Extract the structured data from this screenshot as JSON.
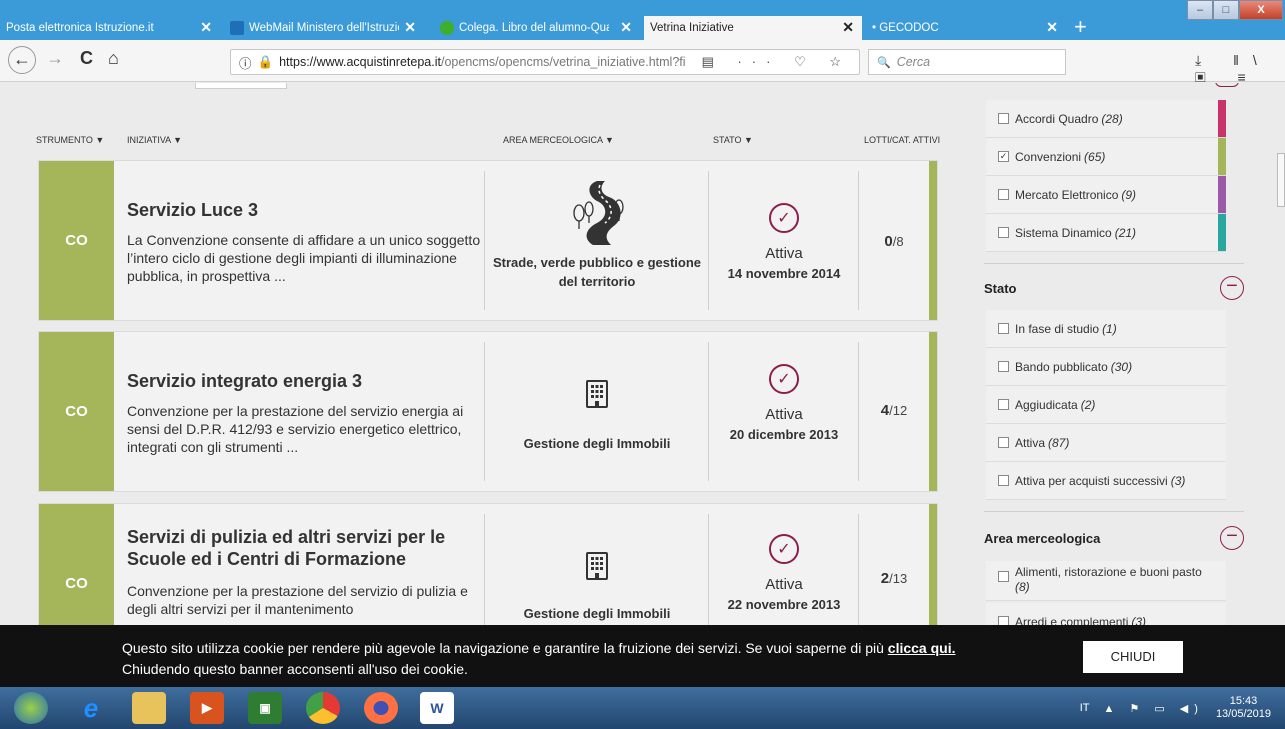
{
  "browser": {
    "tabs": [
      {
        "label": "Posta elettronica Istruzione.it",
        "icon": "none"
      },
      {
        "label": "WebMail Ministero dell'Istruzio",
        "icon": "blue"
      },
      {
        "label": "Colega. Libro del alumno-Qua",
        "icon": "green"
      },
      {
        "label": "Vetrina Iniziative",
        "icon": "none",
        "active": true
      },
      {
        "label": "• GECODOC",
        "icon": "none"
      }
    ],
    "url_host": "https://www.acquistinretepa.it",
    "url_path": "/opencms/opencms/vetrina_iniziative.html?fi",
    "search_placeholder": "Cerca",
    "close_glyph": "✕",
    "new_tab_glyph": "+",
    "min_glyph": "–",
    "max_glyph": "□",
    "win_close_glyph": "X",
    "back_glyph": "←",
    "forward_glyph": "→",
    "reload_glyph": "C",
    "home_glyph": "⌂",
    "info_glyph": "ⓘ",
    "lock_glyph": "🔒",
    "url_icons": "▤ ··· ♡ ☆",
    "search_glyph": "🔍",
    "right_icons": "⤓ ‖\\ ▣ ≡"
  },
  "columns": {
    "strumento": "STRUMENTO ▼",
    "iniziativa": "INIZIATIVA ▼",
    "area": "AREA MERCEOLOGICA ▼",
    "stato": "STATO ▼",
    "lotti": "LOTTI/CAT. ATTIVI"
  },
  "cards": [
    {
      "strumento": "CO",
      "title": "Servizio Luce 3",
      "desc": "La Convenzione consente di affidare a un unico soggetto l’intero ciclo di gestione degli impianti di illuminazione pubblica, in prospettiva ...",
      "area": "Strade, verde pubblico e gestione del territorio",
      "area_icon": "road-trees-icon",
      "stato": "Attiva",
      "date": "14 novembre 2014",
      "lotti_active": "0",
      "lotti_total": "/8"
    },
    {
      "strumento": "CO",
      "title": "Servizio integrato energia 3",
      "desc": "Convenzione per la prestazione del servizio energia ai sensi del D.P.R. 412/93 e servizio energetico elettrico, integrati con gli strumenti ...",
      "area": "Gestione degli Immobili",
      "area_icon": "building-icon",
      "stato": "Attiva",
      "date": "20 dicembre 2013",
      "lotti_active": "4",
      "lotti_total": "/12"
    },
    {
      "strumento": "CO",
      "title": "Servizi di pulizia ed altri servizi per le Scuole ed i Centri di Formazione",
      "desc": "Convenzione per la prestazione del servizio di pulizia e degli altri servizi per il mantenimento",
      "area": "Gestione degli Immobili",
      "area_icon": "building-icon",
      "stato": "Attiva",
      "date": "22 novembre 2013",
      "lotti_active": "2",
      "lotti_total": "/13"
    }
  ],
  "sidebar": {
    "strumento_items": [
      {
        "label": "Accordi Quadro",
        "count": "(28)",
        "checked": false,
        "color": "#c8336a"
      },
      {
        "label": "Convenzioni",
        "count": "(65)",
        "checked": true,
        "color": "#a5b55a"
      },
      {
        "label": "Mercato Elettronico",
        "count": "(9)",
        "checked": false,
        "color": "#9b59a8"
      },
      {
        "label": "Sistema Dinamico",
        "count": "(21)",
        "checked": false,
        "color": "#2aa8a0"
      }
    ],
    "stato_title": "Stato",
    "stato_items": [
      {
        "label": "In fase di studio",
        "count": "(1)"
      },
      {
        "label": "Bando pubblicato",
        "count": "(30)"
      },
      {
        "label": "Aggiudicata",
        "count": "(2)"
      },
      {
        "label": "Attiva",
        "count": "(87)"
      },
      {
        "label": "Attiva per acquisti successivi",
        "count": "(3)"
      }
    ],
    "area_title": "Area merceologica",
    "area_items": [
      {
        "label": "Alimenti, ristorazione e buoni pasto",
        "count": "(8)"
      },
      {
        "label": "Arredi e complementi",
        "count": "(3)"
      }
    ],
    "minus_glyph": "−",
    "check_glyph": "✓"
  },
  "cookie": {
    "text": "Questo sito utilizza cookie per rendere più agevole la navigazione e garantire la fruizione dei servizi. Se vuoi saperne di più",
    "link": "clicca qui.",
    "text2": "Chiudendo questo banner acconsenti all'uso dei cookie.",
    "button": "CHIUDI"
  },
  "taskbar": {
    "lang": "IT",
    "time": "15:43",
    "date": "13/05/2019",
    "tray_icons": "▲ ⚑ ▭ ◀)"
  },
  "colors": {
    "accent_green": "#a5b55a",
    "accent_maroon": "#8b1f4b",
    "tabbar_blue": "#3b9bd9"
  }
}
